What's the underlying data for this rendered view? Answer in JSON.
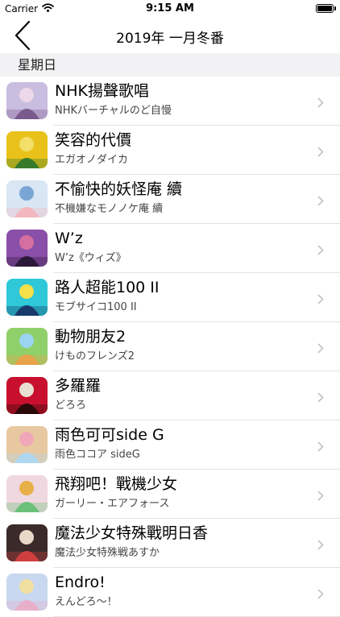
{
  "status_bar": {
    "carrier": "Carrier",
    "time": "9:15 AM"
  },
  "nav": {
    "title": "2019年 一月冬番"
  },
  "section": {
    "title": "星期日"
  },
  "items": [
    {
      "title": "NHK揚聲歌唱",
      "subtitle": "NHKバーチャルのど自慢",
      "colors": [
        "#c9bde0",
        "#7a5a8c",
        "#ecd8e8"
      ]
    },
    {
      "title": "笑容的代價",
      "subtitle": "エガオノダイカ",
      "colors": [
        "#e8c21a",
        "#3a7a2a",
        "#f3df6a"
      ]
    },
    {
      "title": "不愉快的妖怪庵 續",
      "subtitle": "不機嫌なモノノケ庵 續",
      "colors": [
        "#d9e6f3",
        "#f2b8c0",
        "#7aa6d6"
      ]
    },
    {
      "title": "W’z",
      "subtitle": "W’z《ウィズ》",
      "colors": [
        "#8a4fa8",
        "#2c1a3a",
        "#d46fa0"
      ]
    },
    {
      "title": "路人超能100 II",
      "subtitle": "モブサイコ100 II",
      "colors": [
        "#2fc8d8",
        "#1a3a6a",
        "#f5e04a"
      ]
    },
    {
      "title": "動物朋友2",
      "subtitle": "けものフレンズ2",
      "colors": [
        "#8fd06a",
        "#e8a24a",
        "#9ad4f0"
      ]
    },
    {
      "title": "多羅羅",
      "subtitle": "どろろ",
      "colors": [
        "#c8102e",
        "#2a0a0a",
        "#e8e0d0"
      ]
    },
    {
      "title": "雨色可可side G",
      "subtitle": "雨色ココア sideG",
      "colors": [
        "#e8c8a0",
        "#b0d8f0",
        "#f0a8b8"
      ]
    },
    {
      "title": "飛翔吧！戰機少女",
      "subtitle": "ガーリー・エアフォース",
      "colors": [
        "#f0d8e0",
        "#6ac07a",
        "#e8b048"
      ]
    },
    {
      "title": "魔法少女特殊戰明日香",
      "subtitle": "魔法少女特殊戦あすか",
      "colors": [
        "#3a2a2a",
        "#d04040",
        "#e8d8c8"
      ]
    },
    {
      "title": "Endro!",
      "subtitle": "えんどろ～！",
      "colors": [
        "#c8d8f0",
        "#e8b0c8",
        "#f0e0a0"
      ]
    }
  ]
}
